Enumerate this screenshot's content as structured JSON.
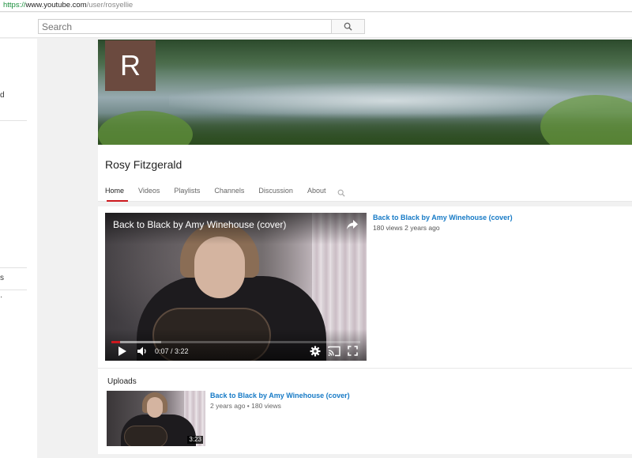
{
  "browser": {
    "url_protocol": "https://",
    "url_host": "www.youtube.com",
    "url_path": "/user/rosyellie"
  },
  "masthead": {
    "search_placeholder": "Search",
    "search_icon": "search-icon"
  },
  "guide": {
    "fragments": [
      "d",
      "s",
      "·"
    ]
  },
  "channel": {
    "avatar_letter": "R",
    "name": "Rosy Fitzgerald",
    "tabs": [
      {
        "label": "Home",
        "active": true
      },
      {
        "label": "Videos",
        "active": false
      },
      {
        "label": "Playlists",
        "active": false
      },
      {
        "label": "Channels",
        "active": false
      },
      {
        "label": "Discussion",
        "active": false
      },
      {
        "label": "About",
        "active": false
      }
    ],
    "tab_search_icon": "search-icon"
  },
  "featured": {
    "player_title": "Back to Black by Amy Winehouse (cover)",
    "current_time": "0:07",
    "duration": "3:22",
    "time_display": "0:07 / 3:22",
    "progress_fraction": 0.035,
    "loaded_fraction": 0.2,
    "title": "Back to Black by Amy Winehouse (cover)",
    "meta": "180 views  2 years ago"
  },
  "uploads": {
    "heading": "Uploads",
    "items": [
      {
        "title": "Back to Black by Amy Winehouse (cover)",
        "meta": "2 years ago • 180 views",
        "duration": "3:23"
      }
    ]
  },
  "colors": {
    "accent_red": "#cc181e",
    "link_blue": "#167ac6",
    "avatar_bg": "#6b4a3f"
  }
}
